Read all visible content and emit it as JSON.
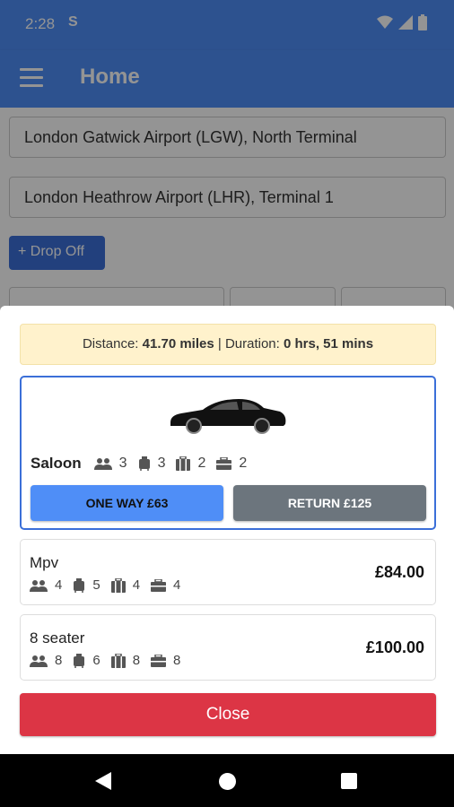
{
  "status_bar": {
    "time": "2:28",
    "sim_icon": "S"
  },
  "app_bar": {
    "title": "Home"
  },
  "form": {
    "pickup": "London Gatwick Airport (LGW), North Terminal",
    "dropoff": "London Heathrow Airport (LHR), Terminal 1",
    "dropoff_button": "+ Drop Off"
  },
  "modal": {
    "distance_label": "Distance:",
    "distance_value": "41.70 miles",
    "separator": "|",
    "duration_label": "Duration:",
    "duration_value": "0 hrs, 51 mins",
    "selected_vehicle": {
      "name": "Saloon",
      "passengers": "3",
      "hand_luggage": "3",
      "suitcases": "2",
      "briefcases": "2",
      "one_way_label": "ONE WAY £63",
      "return_label": "RETURN £125"
    },
    "vehicles": [
      {
        "name": "Mpv",
        "passengers": "4",
        "hand_luggage": "5",
        "suitcases": "4",
        "briefcases": "4",
        "price": "£84.00"
      },
      {
        "name": "8 seater",
        "passengers": "8",
        "hand_luggage": "6",
        "suitcases": "8",
        "briefcases": "8",
        "price": "£100.00"
      }
    ],
    "close_label": "Close"
  },
  "colors": {
    "primary": "#4f8ef7",
    "danger": "#dc3545",
    "secondary": "#6c757d",
    "banner": "#fff2cc"
  },
  "icons": [
    "menu-icon",
    "wifi-icon",
    "signal-icon",
    "battery-icon",
    "car-icon",
    "passengers-icon",
    "hand-luggage-icon",
    "suitcase-icon",
    "briefcase-icon",
    "back-icon",
    "home-icon",
    "recent-apps-icon"
  ]
}
